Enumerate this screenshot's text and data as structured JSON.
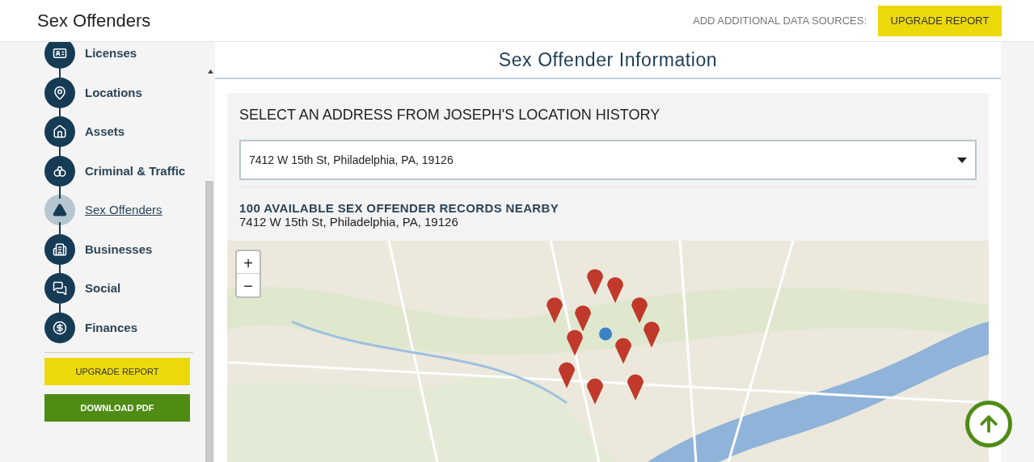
{
  "header": {
    "title": "Sex Offenders",
    "sources_label": "ADD ADDITIONAL DATA SOURCES:",
    "upgrade_button": "UPGRADE REPORT"
  },
  "sidebar": {
    "items": [
      {
        "label": "Licenses",
        "selected": false
      },
      {
        "label": "Locations",
        "selected": false
      },
      {
        "label": "Assets",
        "selected": false
      },
      {
        "label": "Criminal & Traffic",
        "selected": false
      },
      {
        "label": "Sex Offenders",
        "selected": true
      },
      {
        "label": "Businesses",
        "selected": false
      },
      {
        "label": "Social",
        "selected": false
      },
      {
        "label": "Finances",
        "selected": false
      }
    ],
    "upgrade_button": "UPGRADE REPORT",
    "download_button": "DOWNLOAD PDF"
  },
  "main": {
    "title": "Sex Offender Information",
    "select_heading": "SELECT AN ADDRESS FROM JOSEPH'S LOCATION HISTORY",
    "address_select": "7412 W 15th St, Philadelphia, PA, 19126",
    "records_heading": "100 AVAILABLE SEX OFFENDER RECORDS NEARBY",
    "records_address": "7412 W 15th St, Philadelphia, PA, 19126",
    "map": {
      "kind": "picture",
      "zoom_in": "+",
      "zoom_out": "−"
    }
  }
}
